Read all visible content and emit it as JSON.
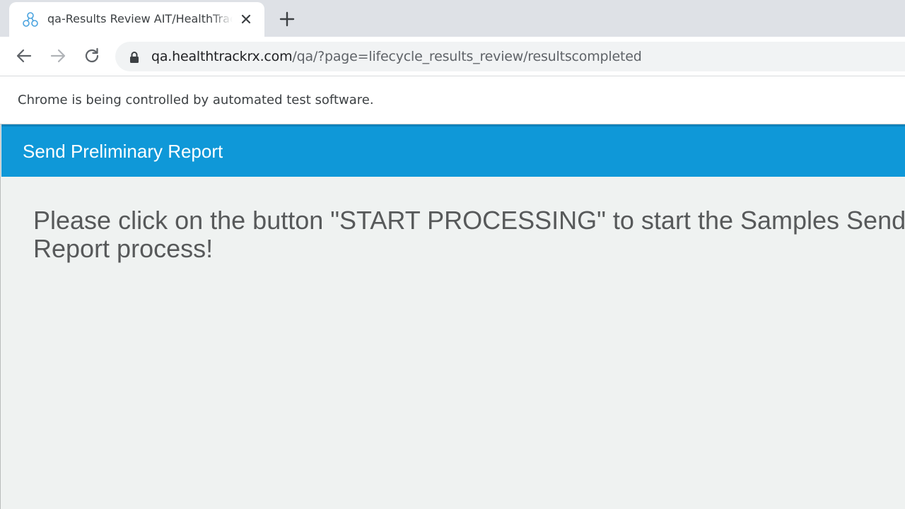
{
  "browser": {
    "tab": {
      "title": "qa-Results Review AIT/HealthTrackRx",
      "favicon": "molecule-icon"
    },
    "new_tab_icon": "plus-icon",
    "nav": {
      "back_icon": "back-arrow-icon",
      "forward_icon": "forward-arrow-icon",
      "reload_icon": "reload-icon"
    },
    "address": {
      "host": "qa.healthtrackrx.com",
      "path": "/qa/?page=lifecycle_results_review/resultscompleted",
      "lock_icon": "lock-icon"
    },
    "infobar": {
      "text": "Chrome is being controlled by automated test software."
    }
  },
  "page": {
    "header": {
      "title": "Send Preliminary Report",
      "color": "#0f98d8"
    },
    "message": "Please click on the button \"START PROCESSING\" to start the Samples Send Report process!"
  }
}
